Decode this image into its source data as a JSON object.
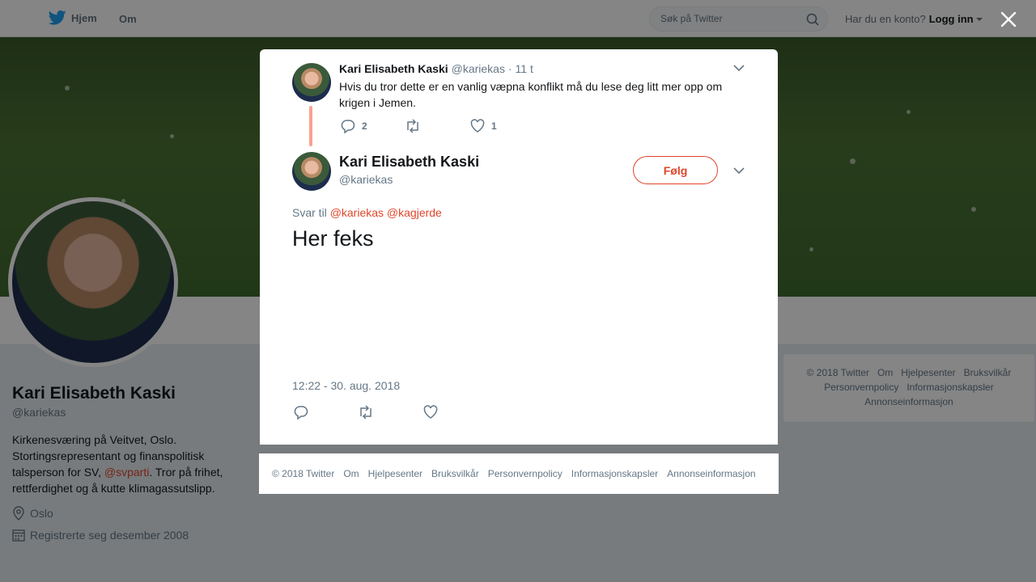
{
  "nav": {
    "home_label": "Hjem",
    "about_label": "Om"
  },
  "search": {
    "placeholder": "Søk på Twitter"
  },
  "account": {
    "prompt": "Har du en konto?",
    "login_label": "Logg inn"
  },
  "profile": {
    "name": "Kari Elisabeth Kaski",
    "handle": "@kariekas",
    "bio_part1": "Kirkenesværing på Veitvet, Oslo. Stortingsrepresentant og finanspolitisk talsperson for SV, ",
    "bio_mention": "@svparti",
    "bio_part2": ". Tror på frihet, rettferdighet og å kutte klimagassutslipp.",
    "location": "Oslo",
    "joined": "Registrerte seg desember 2008"
  },
  "right_footer": {
    "items": [
      "© 2018 Twitter",
      "Om",
      "Hjelpesenter",
      "Bruksvilkår",
      "Personvernpolicy",
      "Informasjonskapsler",
      "Annonseinformasjon"
    ]
  },
  "ancestor_tweet": {
    "name": "Kari Elisabeth Kaski",
    "handle": "@kariekas",
    "time": "· 11 t",
    "text": "Hvis du tror dette er en vanlig væpna konflikt må du lese deg litt mer opp om krigen i Jemen.",
    "reply_count": "2",
    "like_count": "1"
  },
  "main_tweet": {
    "name": "Kari Elisabeth Kaski",
    "handle": "@kariekas",
    "follow_label": "Følg",
    "reply_to_label": "Svar til",
    "reply_to_1": "@kariekas",
    "reply_to_2": "@kagjerde",
    "text": "Her feks",
    "timestamp": "12:22 - 30. aug. 2018"
  },
  "modal_footer": {
    "items": [
      "© 2018 Twitter",
      "Om",
      "Hjelpesenter",
      "Bruksvilkår",
      "Personvernpolicy",
      "Informasjonskapsler",
      "Annonseinformasjon"
    ]
  },
  "colors": {
    "accent": "#e0452a",
    "twitter_blue": "#1da1f2",
    "muted": "#657786",
    "thread_line": "#f7a38e"
  }
}
